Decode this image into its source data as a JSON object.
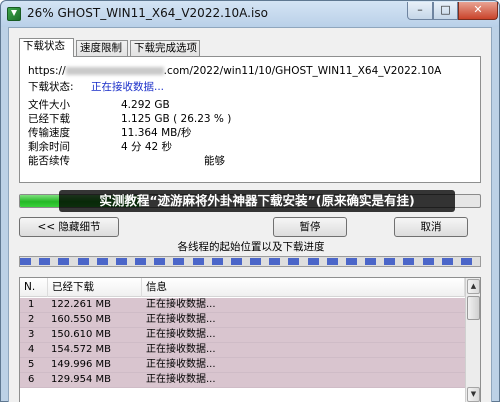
{
  "window": {
    "title": "26% GHOST_WIN11_X64_V2022.10A.iso",
    "controls": {
      "minimize": "–",
      "maximize": "□",
      "close": "✕"
    },
    "icon": "download-arrow-icon"
  },
  "tabs": [
    {
      "label": "下载状态",
      "active": true
    },
    {
      "label": "速度限制",
      "active": false
    },
    {
      "label": "下载完成选项",
      "active": false
    }
  ],
  "status": {
    "url_prefix": "https://",
    "url_suffix": ".com/2022/win11/10/GHOST_WIN11_X64_V2022.10A",
    "rows": [
      {
        "label": "下载状态:",
        "value": "正在接收数据..."
      },
      {
        "label": "文件大小",
        "value": "4.292  GB"
      },
      {
        "label": "已经下载",
        "value": "1.125  GB  ( 26.23 % )"
      },
      {
        "label": "传输速度",
        "value": "11.364  MB/秒"
      },
      {
        "label": "剩余时间",
        "value": "4 分 42 秒"
      },
      {
        "label": "能否续传",
        "value": "能够"
      }
    ]
  },
  "progress": {
    "percent": 26.23,
    "color": "#25b826"
  },
  "banner": "实测教程“迹游麻将外卦神器下载安装”(原来确实是有挂)",
  "buttons": {
    "hide_details": "<< 隐藏细节",
    "pause": "暂停",
    "cancel": "取消"
  },
  "threads": {
    "title": "各线程的起始位置以及下载进度",
    "count": 24,
    "color": "#4b66c9"
  },
  "table": {
    "headers": [
      "N.",
      "已经下载",
      "信息"
    ],
    "rows": [
      {
        "n": "1",
        "downloaded": "122.261  MB",
        "info": "正在接收数据..."
      },
      {
        "n": "2",
        "downloaded": "160.550  MB",
        "info": "正在接收数据..."
      },
      {
        "n": "3",
        "downloaded": "150.610  MB",
        "info": "正在接收数据..."
      },
      {
        "n": "4",
        "downloaded": "154.572  MB",
        "info": "正在接收数据..."
      },
      {
        "n": "5",
        "downloaded": "149.996  MB",
        "info": "正在接收数据..."
      },
      {
        "n": "6",
        "downloaded": "129.954  MB",
        "info": "正在接收数据..."
      }
    ],
    "row_color": "#d9c5cf"
  }
}
